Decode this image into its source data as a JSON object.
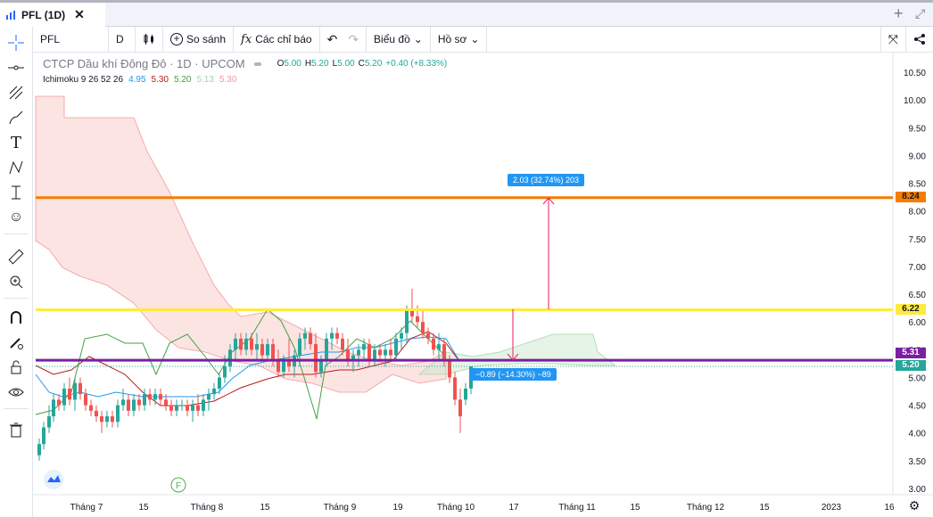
{
  "tab": {
    "title": "PFL (1D)",
    "close": "✕"
  },
  "window": {
    "plus": "+",
    "expand": "⤢"
  },
  "toolbar": {
    "symbol": "PFL",
    "interval": "D",
    "compare": "So sánh",
    "indicators": "Các chỉ báo",
    "chart_type": "Biểu đồ",
    "profile": "Hồ sơ"
  },
  "legend": {
    "title": "CTCP Dầu khí Đông Đô · 1D · UPCOM",
    "open_label": "O",
    "open": "5.00",
    "high_label": "H",
    "high": "5.20",
    "low_label": "L",
    "low": "5.00",
    "close_label": "C",
    "close": "5.20",
    "change": "+0.40 (+8.33%)",
    "ichimoku_name": "Ichimoku 9 26 52 26",
    "ich_v1": "4.95",
    "ich_v2": "5.30",
    "ich_v3": "5.20",
    "ich_v4": "5.13",
    "ich_v5": "5.30"
  },
  "colors": {
    "up": "#26a69a",
    "down": "#ef5350",
    "orange_line": "#f57c00",
    "yellow_line": "#ffeb3b",
    "purple_line": "#7b1fa2",
    "tenkan": "#2196f3",
    "kijun": "#b71c1c",
    "chikou": "#43a047",
    "cloud_bear": "#f8c4c0",
    "cloud_bull": "#c8e6c9",
    "measure": "#2196f3"
  },
  "price_axis": [
    "10.50",
    "10.00",
    "9.50",
    "9.00",
    "8.50",
    "8.00",
    "7.50",
    "7.00",
    "6.50",
    "6.00",
    "5.50",
    "5.00",
    "4.50",
    "4.00",
    "3.50",
    "3.00"
  ],
  "price_labels": {
    "orange": "8.24",
    "yellow": "6.22",
    "purple": "5.31",
    "last": "5.20"
  },
  "time_axis": [
    "Tháng 7",
    "15",
    "Tháng 8",
    "15",
    "Tháng 9",
    "19",
    "Tháng 10",
    "17",
    "Tháng 11",
    "15",
    "Tháng 12",
    "15",
    "2023",
    "16"
  ],
  "measure_up": "2.03 (32.74%) 203",
  "measure_down": "−0.89 (−14.30%) −89",
  "icons": [
    "crosshair-icon",
    "trend-line-icon",
    "fib-icon",
    "brush-icon",
    "text-icon",
    "pattern-icon",
    "forecast-icon",
    "emoji-icon",
    "ruler-icon",
    "zoom-icon",
    "magnet-icon",
    "lock-draw-icon",
    "lock-icon",
    "eye-icon",
    "trash-icon"
  ],
  "chart_data": {
    "type": "candlestick",
    "y_range": [
      3.0,
      10.7
    ],
    "horizontal_lines": [
      8.24,
      6.22,
      5.31
    ],
    "last_price": 5.2
  }
}
